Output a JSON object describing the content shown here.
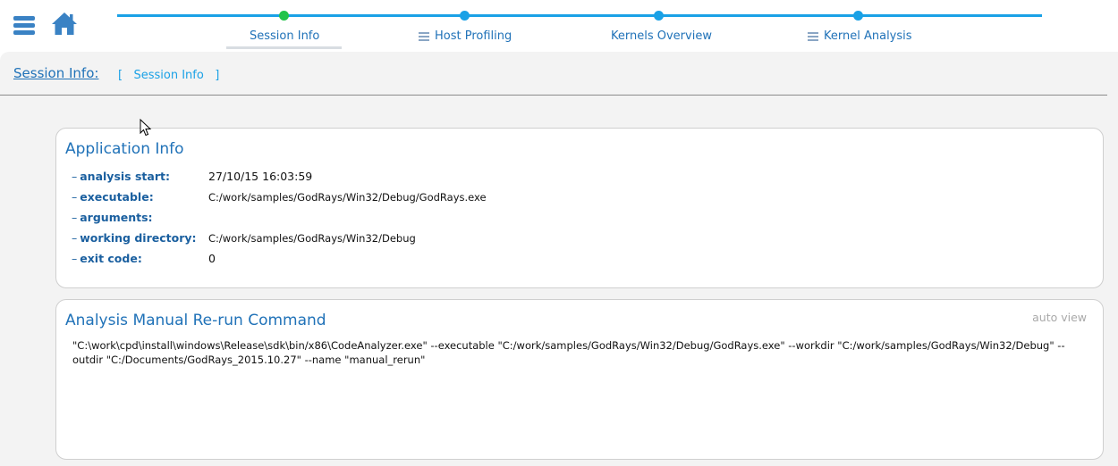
{
  "nav": {
    "steps": [
      {
        "label": "Session Info",
        "active": true,
        "has_list_icon": false
      },
      {
        "label": "Host Profiling",
        "active": false,
        "has_list_icon": true
      },
      {
        "label": "Kernels Overview",
        "active": false,
        "has_list_icon": false
      },
      {
        "label": "Kernel Analysis",
        "active": false,
        "has_list_icon": true
      }
    ],
    "menu_icon": "hamburger-menu-icon",
    "home_icon": "home-icon"
  },
  "session": {
    "header": "Session Info:",
    "crumb_open": "[",
    "crumb_link": "Session Info",
    "crumb_close": "]"
  },
  "app_info": {
    "title": "Application Info",
    "rows": [
      {
        "label": "analysis start:",
        "value": "27/10/15 16:03:59"
      },
      {
        "label": "executable:",
        "value": "C:/work/samples/GodRays/Win32/Debug/GodRays.exe"
      },
      {
        "label": "arguments:",
        "value": ""
      },
      {
        "label": "working directory:",
        "value": "C:/work/samples/GodRays/Win32/Debug"
      },
      {
        "label": "exit code:",
        "value": "0"
      }
    ]
  },
  "rerun": {
    "title": "Analysis Manual Re-run Command",
    "auto_view": "auto view",
    "command": "\"C:\\work\\cpd\\install\\windows\\Release\\sdk\\bin/x86\\CodeAnalyzer.exe\" --executable \"C:/work/samples/GodRays/Win32/Debug/GodRays.exe\" --workdir \"C:/work/samples/GodRays/Win32/Debug\" --outdir \"C:/Documents/GodRays_2015.10.27\" --name \"manual_rerun\""
  },
  "colors": {
    "accent": "#1aa1e6",
    "active_step": "#22c34a",
    "label": "#1a5f9f",
    "title": "#2072b8"
  }
}
